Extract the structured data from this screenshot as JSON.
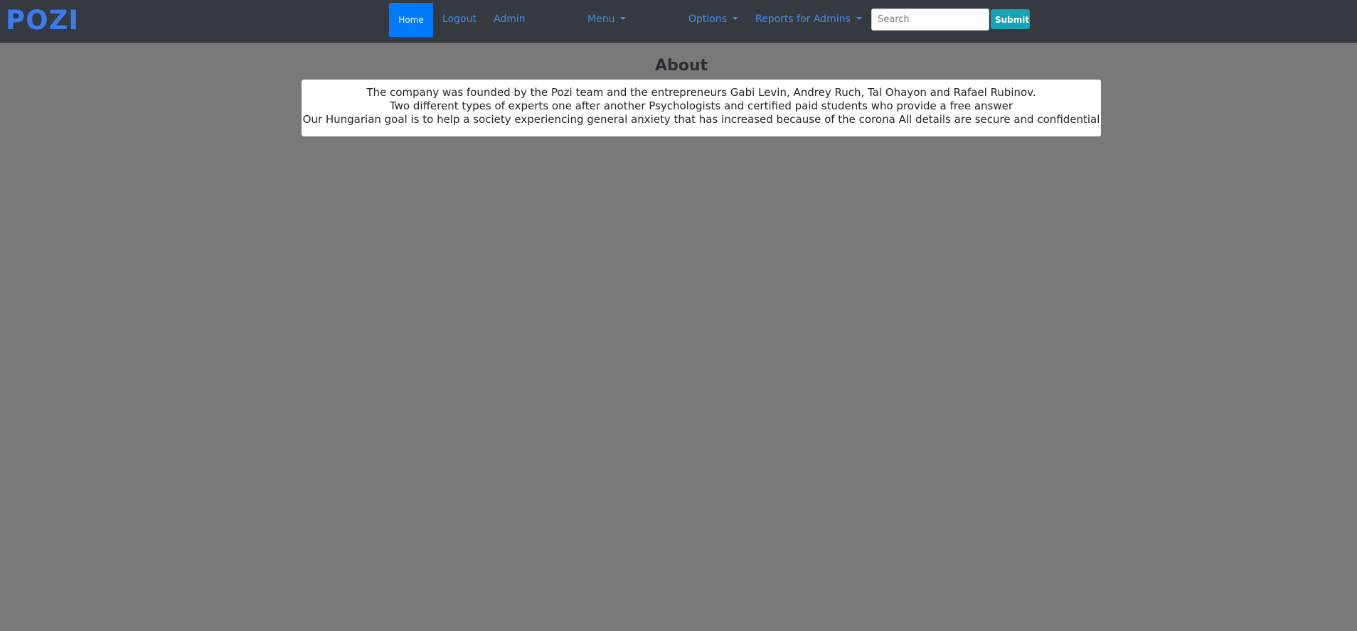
{
  "brand": {
    "logo_text": "POZI"
  },
  "nav": {
    "home": "Home",
    "logout": "Logout",
    "admin": "Admin",
    "menu": "Menu",
    "options": "Options",
    "reports": "Reports for Admins"
  },
  "search": {
    "placeholder": "Search",
    "value": "",
    "submit_label": "Submit"
  },
  "about": {
    "title": "About",
    "lines": [
      "The company was founded by the Pozi team and the entrepreneurs Gabi Levin, Andrey Ruch, Tal Ohayon and Rafael Rubinov.",
      "Two different types of experts one after another Psychologists and certified paid students who provide a free answer",
      "Our Hungarian goal is to help a society experiencing general anxiety that has increased because of the corona All details are secure and confidential"
    ]
  },
  "colors": {
    "navbar": "#343a40",
    "page_background": "#797979",
    "accent": "#007bff",
    "link": "#3f8ef0",
    "submit": "#17a2b8"
  }
}
